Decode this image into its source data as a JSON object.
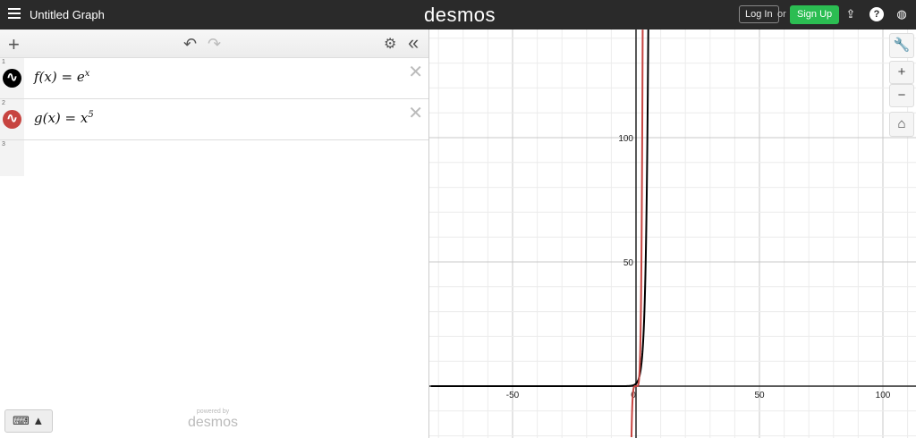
{
  "header": {
    "title": "Untitled Graph",
    "logo": "desmos",
    "login": "Log In",
    "or": "or",
    "signup": "Sign Up",
    "icons": [
      "menu-icon",
      "share-icon",
      "help-icon",
      "globe-icon"
    ]
  },
  "toolbar": {
    "add": "+",
    "undo": "↶",
    "redo": "↷",
    "settings": "⚙",
    "collapse": "«"
  },
  "expressions": [
    {
      "index": "1",
      "latex_lhs": "f(x) = e",
      "sup": "x",
      "color": "#000000"
    },
    {
      "index": "2",
      "latex_lhs": "g(x) = x",
      "sup": "5",
      "color": "#c74440"
    },
    {
      "index": "3"
    }
  ],
  "footer": {
    "powered": "powered by",
    "brand": "desmos",
    "keyboard": "⌨ ▲"
  },
  "graph_controls": {
    "wrench": "🔧",
    "zoom_in": "+",
    "zoom_out": "−",
    "home": "⌂"
  },
  "chart_data": {
    "type": "line",
    "x_ticks": [
      "-50",
      "0",
      "50",
      "100"
    ],
    "y_ticks": [
      "50",
      "100"
    ],
    "xlim": [
      -83,
      114
    ],
    "ylim": [
      -21,
      143
    ],
    "series": [
      {
        "name": "f(x)=e^x",
        "color": "#000000"
      },
      {
        "name": "g(x)=x^5",
        "color": "#c74440"
      }
    ],
    "grid": true
  }
}
